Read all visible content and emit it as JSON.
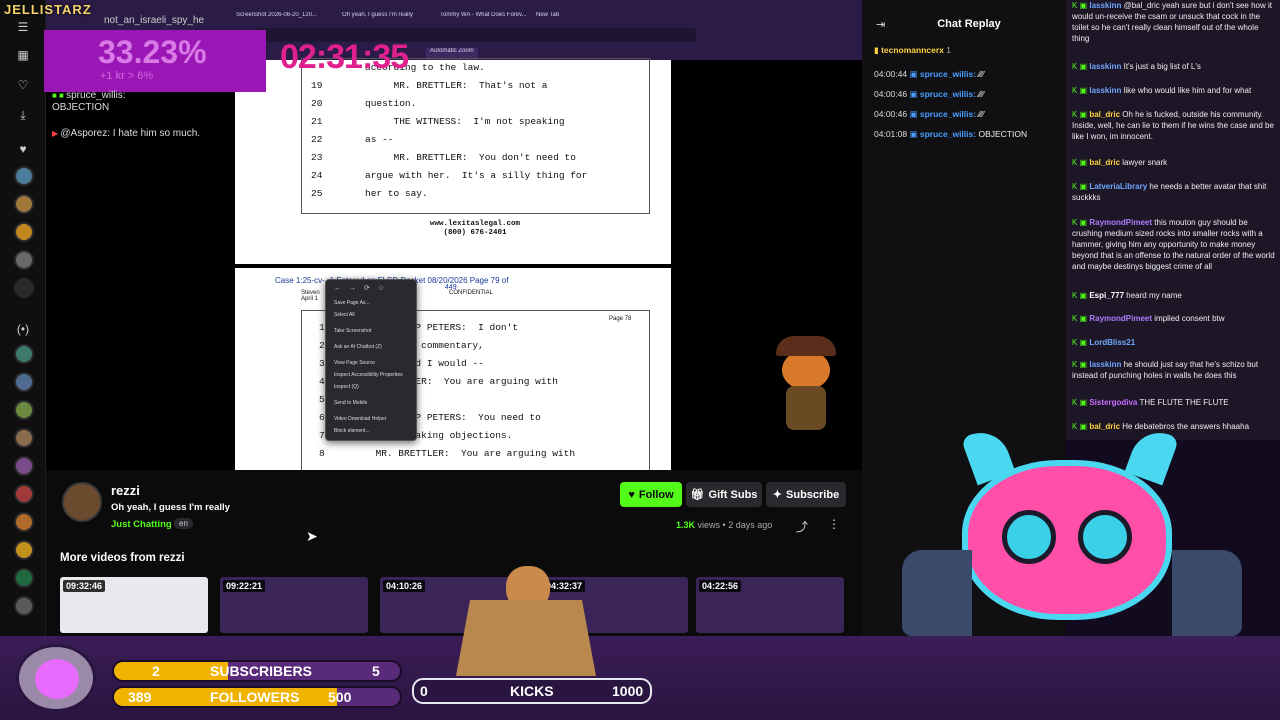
{
  "overlay": {
    "brand": "JELLISTARZ",
    "download_pct": "33.23%",
    "download_sub": "+1 kr > 6%",
    "timer": "02:31:35",
    "overlay_chat": [
      {
        "user": "not_an_israeli_spy_he",
        "text": ""
      },
      {
        "user": "spruce_willis:",
        "text": "OBJECTION"
      },
      {
        "user": "@Asporez:",
        "text": "I hate him so much."
      }
    ]
  },
  "browser": {
    "tabs": [
      "Screenshot 2026-08-20_120...",
      "Oh yeah, I guess I'm really",
      "Tommy WA - What Does Forev...",
      "New Tab"
    ],
    "zoom": "Automatic Zoom"
  },
  "pdf": {
    "page1_lines": [
      {
        "n": "",
        "t": "according to the law."
      },
      {
        "n": "19",
        "t": "     MR. BRETTLER:  That's not a"
      },
      {
        "n": "20",
        "t": "question."
      },
      {
        "n": "21",
        "t": "     THE WITNESS:  I'm not speaking"
      },
      {
        "n": "22",
        "t": "as --"
      },
      {
        "n": "23",
        "t": "     MR. BRETTLER:  You don't need to"
      },
      {
        "n": "24",
        "t": "argue with her.  It's a silly thing for"
      },
      {
        "n": "25",
        "t": "her to say."
      }
    ],
    "footer_site": "www.lexitaslegal.com",
    "footer_phone": "(800) 676-2401",
    "case_header": "Case 1:25-cv-         -1   Entered on FLSD Docket 08/20/2026   Page 79 of",
    "case_pages": "449",
    "case_witness": "Steven",
    "case_date": "April 1",
    "confidential": "CONFIDENTIAL",
    "page_num": "Page 78",
    "page2_lines": [
      {
        "n": "1",
        "t": "          UMP PETERS:  I don't"
      },
      {
        "n": "2",
        "t": "          ur commentary,"
      },
      {
        "n": "3",
        "t": "          And I would --"
      },
      {
        "n": "4",
        "t": "          TLER:  You are arguing with"
      },
      {
        "n": "5",
        "t": ""
      },
      {
        "n": "6",
        "t": "          UMP PETERS:  You need to"
      },
      {
        "n": "7",
        "t": "          peaking objections."
      },
      {
        "n": "8",
        "t": "     MR. BRETTLER:  You are arguing with"
      }
    ],
    "context_menu": [
      "Save Page As...",
      "Select All",
      "Take Screenshot",
      "Ask an AI Chatbot (Z)",
      "View Page Source",
      "Inspect Accessibility Properties",
      "Inspect (Q)",
      "Send to Mobile",
      "Video Download Helper",
      "Block element..."
    ]
  },
  "video_info": {
    "channel": "rezzi",
    "title": "Oh yeah, I guess I'm really",
    "category": "Just Chatting",
    "language": "en",
    "follow": "Follow",
    "gift_subs": "Gift Subs",
    "subscribe": "Subscribe",
    "views": "1.3K",
    "views_label": "views",
    "age": "2 days ago",
    "more_videos": "More videos from rezzi",
    "thumbnails": [
      {
        "duration": "09:32:46"
      },
      {
        "duration": "09:22:21"
      },
      {
        "duration": "04:10:26"
      },
      {
        "duration": "04:32:37"
      },
      {
        "duration": "04:22:56"
      }
    ]
  },
  "chat_replay": {
    "title": "Chat Replay",
    "pinned_user": "tecnomanncerx",
    "pinned_count": "1",
    "messages": [
      {
        "time": "04:00:44",
        "user": "spruce_willis:",
        "text": "⁄⁄⁄⁄"
      },
      {
        "time": "04:00:46",
        "user": "spruce_willis:",
        "text": "⁄⁄⁄⁄"
      },
      {
        "time": "04:00:46",
        "user": "spruce_willis:",
        "text": "⁄⁄⁄⁄"
      },
      {
        "time": "04:01:08",
        "user": "spruce_willis:",
        "text": "OBJECTION"
      }
    ]
  },
  "right_chat": [
    {
      "user": "lasskinn",
      "text": "@bal_dric yeah sure but i don't see how it would un-receive the csam or unsuck that cock in the toilet so he can't really clean himself out of the whole thing",
      "color": "#6fa8ff"
    },
    {
      "user": "lasskinn",
      "text": "It's just a big list of L's",
      "color": "#6fa8ff"
    },
    {
      "user": "lasskinn",
      "text": "like who would like him and for what",
      "color": "#6fa8ff"
    },
    {
      "user": "bal_dric",
      "text": "Oh he is fucked, outside his community. Inside, well, he can lie to them if he wins the case and be like I won, im innocent.",
      "color": "#ffd23f"
    },
    {
      "user": "bal_dric",
      "text": "lawyer snark",
      "color": "#ffd23f"
    },
    {
      "user": "LatveriaLibrary",
      "text": "he needs a better avatar that shit suckkks",
      "color": "#6fa8ff"
    },
    {
      "user": "RaymondPimeet",
      "text": "this mouton guy should be crushing medium sized rocks into smaller rocks with a hammer, giving him any opportunity to make money beyond that is an offense to the natural order of the world and maybe destinys biggest crime of all",
      "color": "#b07cff"
    },
    {
      "user": "Espi_777",
      "text": "heard my name",
      "color": "#ffffff"
    },
    {
      "user": "RaymondPimeet",
      "text": "implied consent btw",
      "color": "#b07cff"
    },
    {
      "user": "LordBliss21",
      "text": "",
      "color": "#6fa8ff"
    },
    {
      "user": "lasskinn",
      "text": "he should just say that he's schizo but instead of punching holes in walls he does this",
      "color": "#6fa8ff"
    },
    {
      "user": "Sistergodiva",
      "text": "THE FLUTE THE FLUTE",
      "color": "#c86bff"
    },
    {
      "user": "bal_dric",
      "text": "He debatebros the answers hhaaha",
      "color": "#ffd23f"
    }
  ],
  "bottom_bar": {
    "subs_current": "2",
    "subs_label": "SUBSCRIBERS",
    "subs_goal": "5",
    "followers_current": "389",
    "followers_label": "FOLLOWERS",
    "followers_goal": "500",
    "kicks_current": "0",
    "kicks_label": "KICKS",
    "kicks_goal": "1000"
  },
  "colors": {
    "accent_green": "#53fc18",
    "follow_bg": "#53fc18",
    "overlay_magenta": "#9b17b5"
  }
}
